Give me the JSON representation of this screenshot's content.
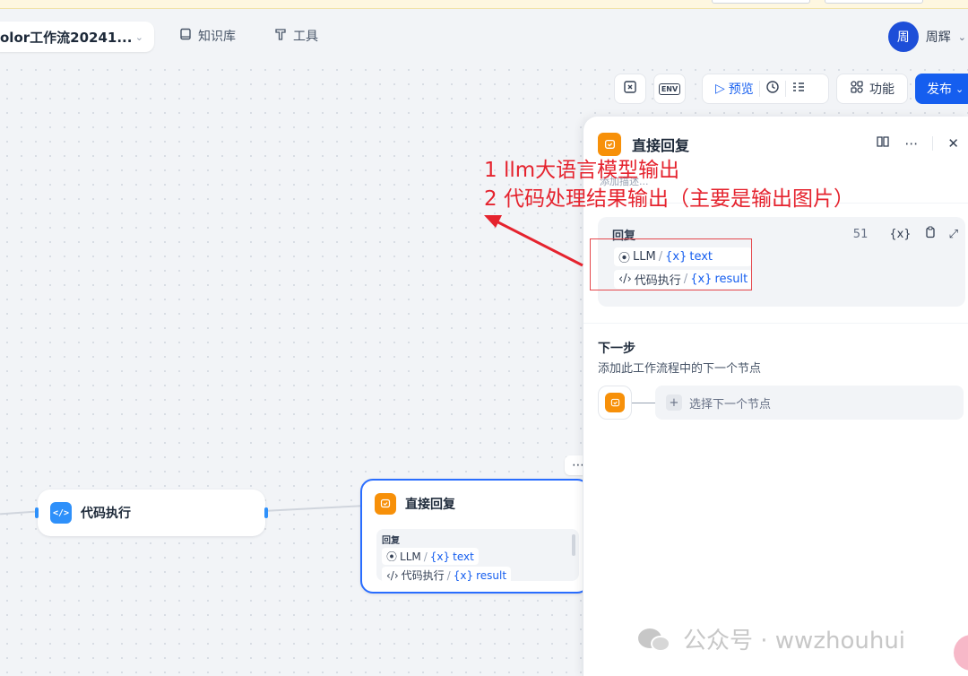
{
  "header": {
    "app_name": "olor工作流20241...",
    "nav": [
      {
        "icon": "book-icon",
        "label": "知识库"
      },
      {
        "icon": "tool-icon",
        "label": "工具"
      }
    ],
    "user": {
      "avatar_text": "周",
      "name": "周辉"
    }
  },
  "toolbar": {
    "env_label": "ENV",
    "preview_label": "预览",
    "features_label": "功能",
    "publish_label": "发布"
  },
  "canvas": {
    "code_node": {
      "title": "代码执行"
    },
    "reply_node": {
      "title": "直接回复",
      "field_label": "回复",
      "chips": [
        {
          "source": "LLM",
          "var": "text"
        },
        {
          "source": "代码执行",
          "var": "result"
        }
      ]
    }
  },
  "panel": {
    "title": "直接回复",
    "desc_placeholder": "添加描述...",
    "reply": {
      "label": "回复",
      "count": "51",
      "chips": [
        {
          "source": "LLM",
          "var": "text"
        },
        {
          "source": "代码执行",
          "var": "result"
        }
      ]
    },
    "next": {
      "title": "下一步",
      "desc": "添加此工作流程中的下一个节点",
      "select_placeholder": "选择下一个节点"
    }
  },
  "annotation": {
    "line1": "1 llm大语言模型输出",
    "line2": "2 代码处理结果输出（主要是输出图片）"
  },
  "watermark": {
    "text": "公众号 · wwzhouhui"
  },
  "colors": {
    "accent": "#155eef",
    "reply_icon": "#f79009",
    "code_icon": "#2e90fa",
    "annotation": "#e5232e"
  }
}
